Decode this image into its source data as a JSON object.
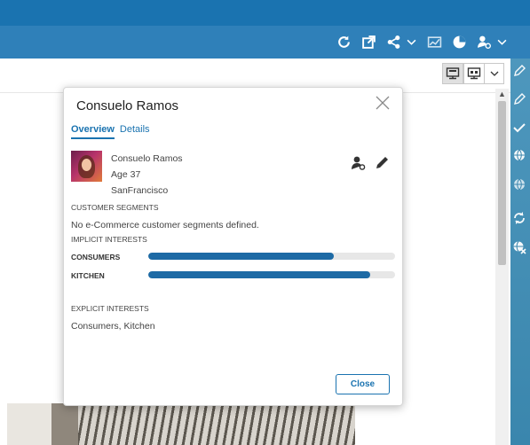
{
  "colors": {
    "topbar": "#1a73b0",
    "toolbar": "#2f80b9",
    "accent": "#1a73b0",
    "bar_fill": "#1d6aa5",
    "rail": "#3a86ad"
  },
  "toolbar": {
    "icons": [
      "refresh-icon",
      "open-external-icon",
      "share-icon",
      "chevron-down-icon",
      "analytics-icon",
      "pie-chart-icon",
      "user-settings-icon",
      "chevron-down-icon"
    ]
  },
  "rail": {
    "icons": [
      "edit-pen-icon",
      "edit-pen-icon",
      "checkmark-icon",
      "globe-icon",
      "globe-icon",
      "sync-icon",
      "globe-x-icon"
    ]
  },
  "view_toggle": {
    "icons": [
      "desktop-preview-icon",
      "desktop-split-icon",
      "chevron-down-icon"
    ]
  },
  "dialog": {
    "title": "Consuelo Ramos",
    "tabs": [
      {
        "label": "Overview",
        "active": true
      },
      {
        "label": "Details",
        "active": false
      }
    ],
    "profile": {
      "name": "Consuelo Ramos",
      "age": "Age 37",
      "location": "SanFrancisco"
    },
    "customer_segments": {
      "label": "CUSTOMER SEGMENTS",
      "text": "No e-Commerce customer segments defined."
    },
    "implicit_interests": {
      "label": "IMPLICIT INTERESTS",
      "items": [
        {
          "label": "CONSUMERS",
          "value": 0.75
        },
        {
          "label": "KITCHEN",
          "value": 0.9
        }
      ]
    },
    "explicit_interests": {
      "label": "EXPLICIT INTERESTS",
      "text": "Consumers, Kitchen"
    },
    "close_label": "Close"
  }
}
